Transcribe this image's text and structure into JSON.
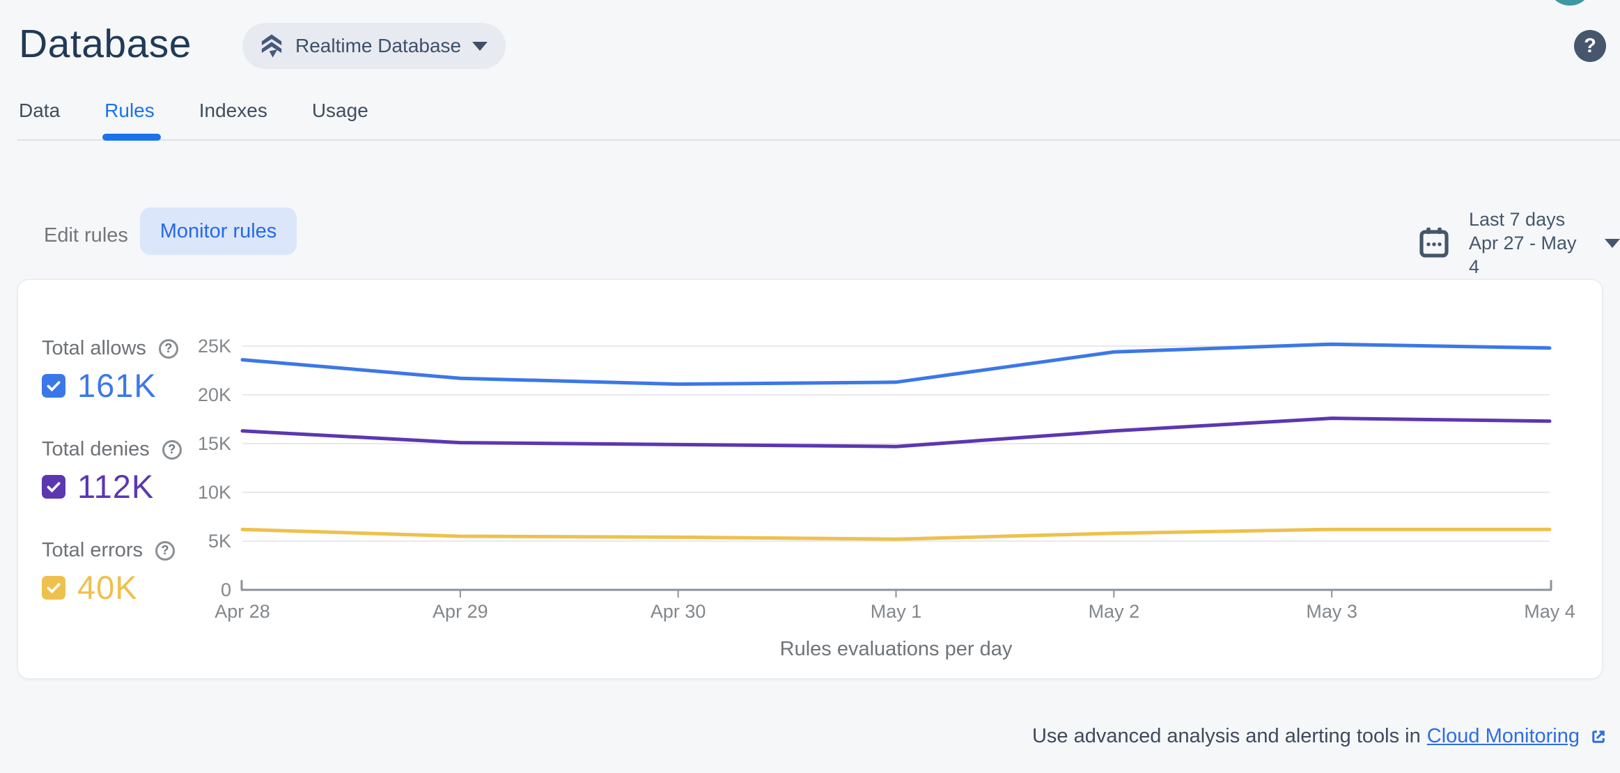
{
  "header": {
    "title": "Database",
    "product_selector": {
      "label": "Realtime Database"
    },
    "help_glyph": "?"
  },
  "tabs": [
    {
      "label": "Data",
      "active": false
    },
    {
      "label": "Rules",
      "active": true
    },
    {
      "label": "Indexes",
      "active": false
    },
    {
      "label": "Usage",
      "active": false
    }
  ],
  "toolbar": {
    "edit_rules_label": "Edit rules",
    "monitor_rules_label": "Monitor rules",
    "date_range": {
      "line1": "Last 7 days",
      "line2": "Apr 27 - May 4"
    }
  },
  "legend": [
    {
      "label": "Total allows",
      "value": "161K",
      "help_glyph": "?",
      "color": "#3b78e7",
      "checked": true
    },
    {
      "label": "Total denies",
      "value": "112K",
      "help_glyph": "?",
      "color": "#5c37b0",
      "checked": true
    },
    {
      "label": "Total errors",
      "value": "40K",
      "help_glyph": "?",
      "color": "#eec04d",
      "checked": true
    }
  ],
  "chart_data": {
    "type": "line",
    "title": "Rules evaluations per day",
    "x_labels": [
      "Apr 28",
      "Apr 29",
      "Apr 30",
      "May 1",
      "May 2",
      "May 3",
      "May 4"
    ],
    "y_ticks": [
      "0",
      "5K",
      "10K",
      "15K",
      "20K",
      "25K"
    ],
    "y_tick_values": [
      0,
      5000,
      10000,
      15000,
      20000,
      25000
    ],
    "ylim": [
      0,
      25000
    ],
    "grid": "horizontal",
    "legend_position": "left",
    "series": [
      {
        "name": "Total allows",
        "color": "#3b78e7",
        "values": [
          23600,
          21700,
          21100,
          21300,
          24400,
          25200,
          24800
        ]
      },
      {
        "name": "Total denies",
        "color": "#5c37b0",
        "values": [
          16300,
          15100,
          14900,
          14700,
          16300,
          17600,
          17300
        ]
      },
      {
        "name": "Total errors",
        "color": "#eec04d",
        "values": [
          6200,
          5500,
          5400,
          5200,
          5800,
          6200,
          6200
        ]
      }
    ]
  },
  "footer": {
    "text": "Use advanced analysis and alerting tools in",
    "link_label": "Cloud Monitoring"
  },
  "colors": {
    "accent_blue": "#1a73e8",
    "allows": "#3b78e7",
    "denies": "#5c37b0",
    "errors": "#eec04d",
    "slate": "#44566b",
    "avatar_teal": "#3e97a1"
  }
}
